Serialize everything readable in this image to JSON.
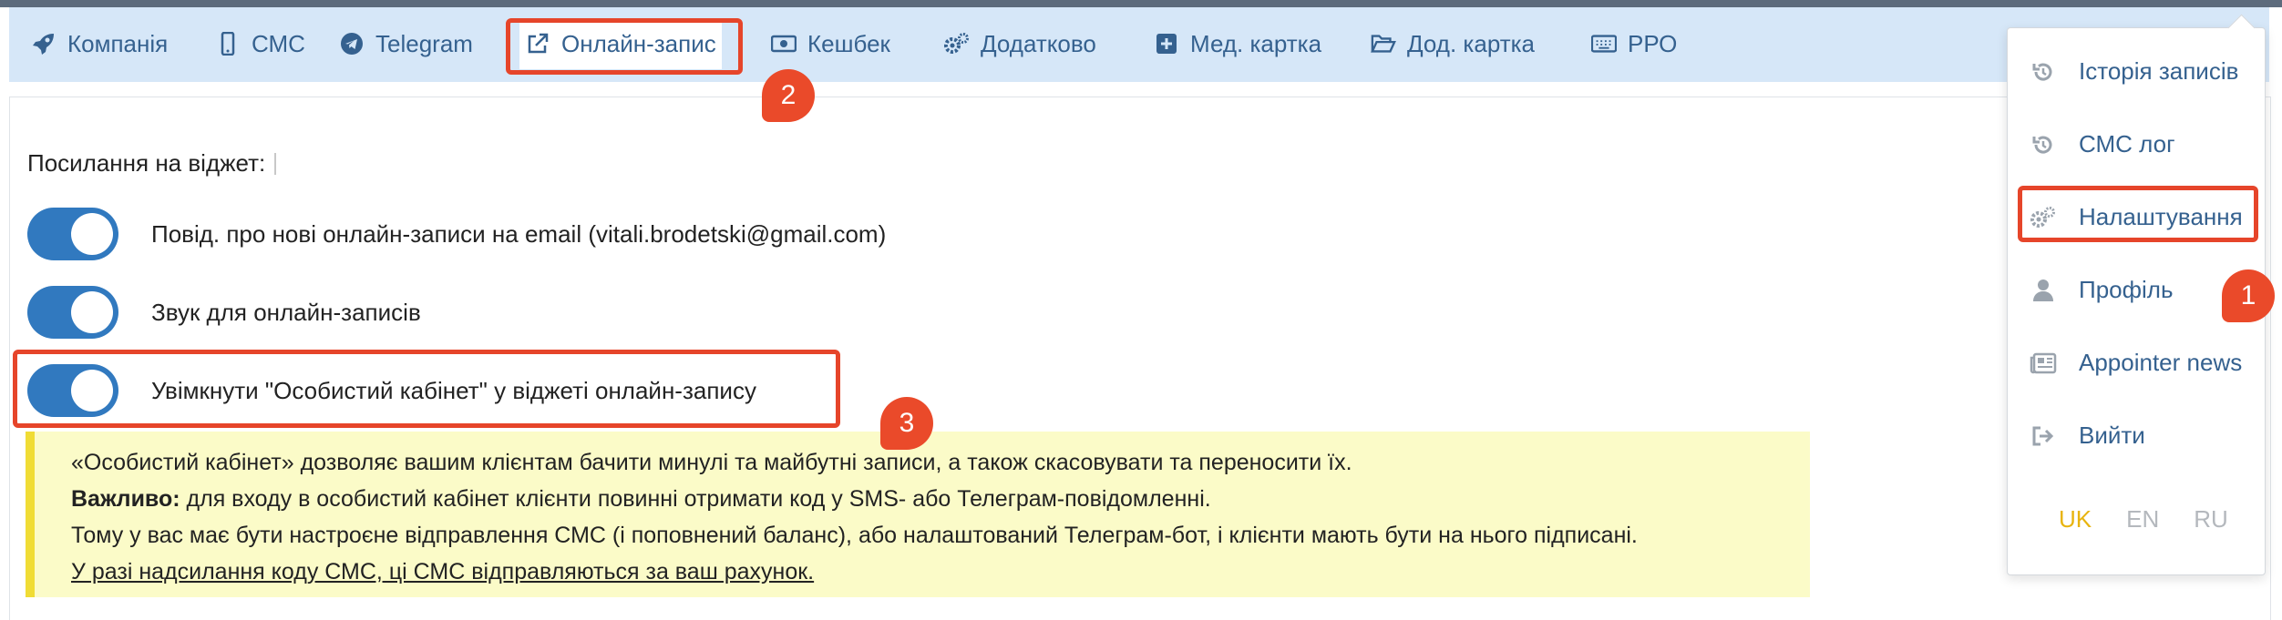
{
  "tabs": [
    {
      "label": "Компанія",
      "icon": "rocket-icon"
    },
    {
      "label": "СМС",
      "icon": "mobile-icon"
    },
    {
      "label": "Telegram",
      "icon": "telegram-icon"
    },
    {
      "label": "Онлайн-запис",
      "icon": "external-link-icon",
      "active": true
    },
    {
      "label": "Кешбек",
      "icon": "money-icon"
    },
    {
      "label": "Додатково",
      "icon": "gears-icon"
    },
    {
      "label": "Мед. картка",
      "icon": "plus-square-icon"
    },
    {
      "label": "Дод. картка",
      "icon": "folder-open-icon"
    },
    {
      "label": "РРО",
      "icon": "keyboard-icon"
    }
  ],
  "settings": {
    "widget_link_label": "Посилання на віджет:",
    "toggles": [
      {
        "label": "Повід. про нові онлайн-записи на email (vitali.brodetski@gmail.com)",
        "on": true
      },
      {
        "label": "Звук для онлайн-записів",
        "on": true
      },
      {
        "label": "Увімкнути \"Особистий кабінет\" у віджеті онлайн-запису",
        "on": true
      }
    ]
  },
  "note": {
    "line1": "«Особистий кабінет» дозволяє вашим клієнтам бачити минулі та майбутні записи, а також скасовувати та переносити їх.",
    "line2_bold": "Важливо:",
    "line2_rest": " для входу в особистий кабінет клієнти повинні отримати код у SMS- або Телеграм-повідомленні.",
    "line3": "Тому у вас має бути настроєне відправлення СМС (і поповнений баланс), або налаштований Телеграм-бот, і клієнти мають бути на нього підписані.",
    "line4": "У разі надсилання коду СМС, ці СМС відправляються за ваш рахунок."
  },
  "menu": {
    "items": [
      {
        "label": "Історія записів",
        "icon": "history-icon"
      },
      {
        "label": "СМС лог",
        "icon": "history-icon"
      },
      {
        "label": "Налаштування",
        "icon": "gears-icon"
      },
      {
        "label": "Профіль",
        "icon": "user-icon"
      },
      {
        "label": "Appointer news",
        "icon": "newspaper-icon"
      },
      {
        "label": "Вийти",
        "icon": "sign-out-icon"
      }
    ],
    "languages": [
      {
        "code": "UK",
        "active": true
      },
      {
        "code": "EN",
        "active": false
      },
      {
        "code": "RU",
        "active": false
      }
    ]
  },
  "callouts": [
    "1",
    "2",
    "3"
  ],
  "colors": {
    "accent": "#3179bf",
    "tab_bar": "#d6e7f8",
    "highlight": "#e6452a",
    "note_bg": "#fbfbc8",
    "lang_active": "#e8b40f"
  }
}
